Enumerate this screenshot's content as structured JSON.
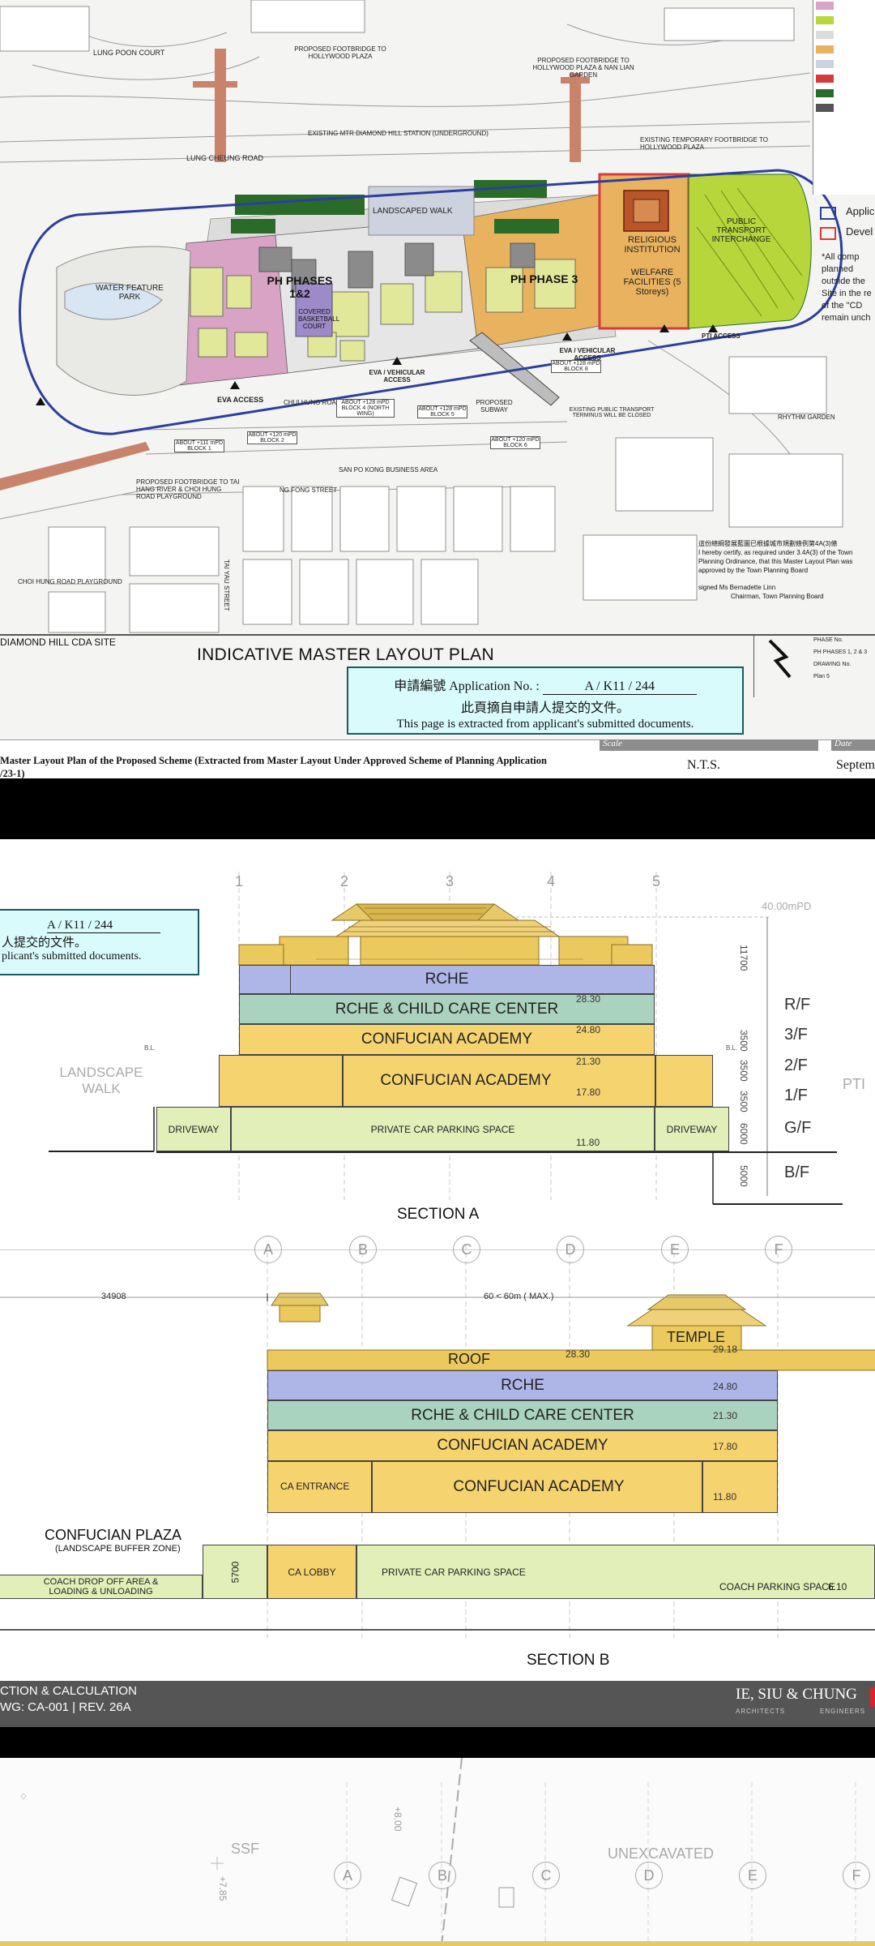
{
  "layout_plan": {
    "title": "INDICATIVE MASTER LAYOUT PLAN",
    "site_name": "DIAMOND HILL CDA SITE",
    "application_box": {
      "app_label": "申請編號 Application No. :",
      "app_no": "A / K11 / 244",
      "zh_note": "此頁摘自申請人提交的文件。",
      "en_note": "This page is extracted from applicant's submitted documents."
    },
    "caption": "Master Layout Plan of the Proposed Scheme (Extracted from Master Layout Under Approved Scheme of Planning Application",
    "caption2": "/23-1)",
    "scale_label": "Scale",
    "scale_value": "N.T.S.",
    "date_label": "Date",
    "date_value": "Septem",
    "zones": {
      "ph12": "PH PHASES 1&2",
      "ph3": "PH PHASE 3",
      "religious": "RELIGIOUS INSTITUTION",
      "welfare": "WELFARE FACILITIES (5 Storeys)",
      "pti": "PUBLIC TRANSPORT INTERCHANGE",
      "water": "WATER FEATURE PARK",
      "landscaped": "LANDSCAPED WALK",
      "covered": "COVERED BASKETBALL COURT"
    },
    "labels": {
      "lung_poon": "LUNG POON COURT",
      "footbridge_hp": "PROPOSED FOOTBRIDGE TO HOLLYWOOD PLAZA",
      "footbridge_nl": "PROPOSED FOOTBRIDGE TO HOLLYWOOD PLAZA & NAN LIAN GARDEN",
      "station": "EXISTING MTR DIAMOND HILL STATION (UNDERGROUND)",
      "lung_cheung": "LUNG CHEUNG ROAD",
      "temp_footbridge": "EXISTING TEMPORARY FOOTBRIDGE TO HOLLYWOOD PLAZA",
      "eva1": "EVA ACCESS",
      "eva2": "EVA / VEHICULAR ACCESS",
      "eva3": "EVA / VEHICULAR ACCESS",
      "pti_access": "PTI ACCESS",
      "chui_hung": "CHUI HUNG ROAD",
      "ng_fong": "NG FONG STREET",
      "san_po_kong": "SAN PO KONG BUSINESS AREA",
      "tai_yau": "TAI YAU STREET",
      "footbridge_tk": "PROPOSED FOOTBRIDGE TO TAI HANG RIVER & CHOI HUNG ROAD PLAYGROUND",
      "choi_hung_pg": "CHOI HUNG ROAD PLAYGROUND",
      "rhythm": "RHYTHM GARDEN",
      "subway": "PROPOSED SUBWAY",
      "existing_pti": "EXISTING PUBLIC TRANSPORT TERMINUS WILL BE CLOSED",
      "approved_zh": "這份總綱發展藍圖已根據城市規劃條例第4A(3)條",
      "approved_en": "I hereby certify, as required under 3.4A(3) of the Town Planning Ordinance, that this Master Layout Plan was approved by the Town Planning Board",
      "signed": "signed  Ms Bernadette Linn",
      "chairman": "Chairman, Town Planning Board",
      "block1": "ABOUT +111 mPD BLOCK 1",
      "block2": "ABOUT +120 mPD BLOCK 2",
      "block4": "ABOUT +128 mPD BLOCK 4 (NORTH WING)",
      "block5": "ABOUT +128 mPD BLOCK 5",
      "block6": "ABOUT +120 mPD BLOCK 6",
      "block8": "ABOUT +128 mPD BLOCK 8"
    },
    "legend": {
      "applic": "Applic",
      "devel": "Devel",
      "note": "*All comp planned outside the Site in the re of the \"CD remain unch"
    },
    "title_block": [
      "PHASE No.",
      "PH PHASES 1, 2 & 3",
      "DRAWING No.",
      "Plan 5"
    ],
    "colors": {
      "boundary": "#2d3f9c",
      "pink": "#d9a3c6",
      "orange": "#e9b25e",
      "lime": "#b6d63b",
      "green_dark": "#2a6b2a",
      "red": "#d43c3c"
    }
  },
  "section_a": {
    "title": "SECTION A",
    "app_no": "A / K11 / 244",
    "zh_note_part": "人提交的文件。",
    "en_note_part": "plicant's submitted documents.",
    "grid": [
      "1",
      "2",
      "3",
      "4",
      "5"
    ],
    "top_level": "40.00mPD",
    "left_label": "LANDSCAPE WALK",
    "right_label": "PTI",
    "floors": [
      {
        "label": "RCHE",
        "level": "24.80"
      },
      {
        "label": "RCHE & CHILD CARE CENTER",
        "level": "21.30"
      },
      {
        "label": "CONFUCIAN ACADEMY",
        "level": "17.80"
      },
      {
        "label": "CONFUCIAN ACADEMY",
        "level": "11.80"
      }
    ],
    "roof_level": "28.30",
    "basement": {
      "left": "DRIVEWAY",
      "center": "PRIVATE CAR PARKING SPACE",
      "right": "DRIVEWAY"
    },
    "floor_names": [
      "R/F",
      "3/F",
      "2/F",
      "1/F",
      "G/F",
      "B/F"
    ],
    "dims": [
      "11700",
      "3500",
      "3500",
      "3500",
      "6000",
      "5000"
    ],
    "bl": "B.L."
  },
  "section_b": {
    "title": "SECTION B",
    "grid": [
      "A",
      "B",
      "C",
      "D",
      "E",
      "F"
    ],
    "dim_left": "34908",
    "dim_main": "60 < 60m ( MAX.)",
    "roof": "ROOF",
    "roof_level": "28.30",
    "temple": "TEMPLE",
    "temple_level": "29.18",
    "floors": [
      {
        "label": "RCHE",
        "level": "24.80"
      },
      {
        "label": "RCHE & CHILD CARE CENTER",
        "level": "21.30"
      },
      {
        "label": "CONFUCIAN ACADEMY",
        "level": "17.80"
      },
      {
        "label": "CONFUCIAN ACADEMY",
        "level": "11.80"
      }
    ],
    "ca_entrance": "CA ENTRANCE",
    "ca_lobby": "CA LOBBY",
    "plaza": "CONFUCIAN PLAZA",
    "plaza_sub": "(LANDSCAPE BUFFER ZONE)",
    "coach_drop": "COACH DROP OFF AREA & LOADING & UNLOADING",
    "dim_5700": "5700",
    "parking": "PRIVATE CAR PARKING SPACE",
    "coach_parking": "COACH PARKING SPACE",
    "level_610": "6.10"
  },
  "footer": {
    "line1": "CTION & CALCULATION",
    "line2": "WG: CA-001 | REV. 26A",
    "firm": "IE, SIU & CHUNG",
    "firm_sub1": "ARCHITECTS",
    "firm_sub2": "ENGINEERS"
  },
  "plan_b": {
    "ssf": "SSF",
    "unexcavated": "UNEXCAVATED",
    "grid": [
      "A",
      "B",
      "C",
      "D",
      "E",
      "F"
    ],
    "lvl1": "+8.00",
    "lvl2": "+7.85"
  }
}
